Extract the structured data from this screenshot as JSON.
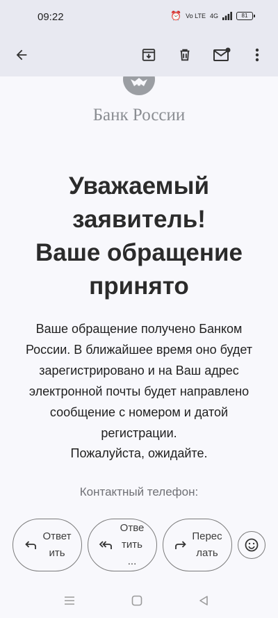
{
  "status_bar": {
    "time": "09:22",
    "volte": "Vo LTE",
    "network": "4G",
    "battery": "81"
  },
  "toolbar": {
    "icons": [
      "back-arrow-icon",
      "archive-icon",
      "delete-icon",
      "mark-unread-icon",
      "more-vert-icon"
    ]
  },
  "email": {
    "bank_name": "Банк России",
    "heading_lines": [
      "Уважаемый",
      "заявитель!",
      "Ваше обращение",
      "принято"
    ],
    "body_lines": [
      "Ваше обращение получено Банком",
      "России. В ближайшее время оно будет",
      "зарегистрировано и на Ваш адрес",
      "электронной почты будет направлено",
      "сообщение с номером и датой",
      "регистрации."
    ],
    "wait": "Пожалуйста, ожидайте.",
    "phone_label": "Контактный телефон:"
  },
  "actions": {
    "reply": [
      "Ответ",
      "ить"
    ],
    "reply_all": [
      "Отве",
      "тить ..."
    ],
    "forward": [
      "Перес",
      "лать"
    ],
    "emoji_icon": "emoji-icon"
  },
  "colors": {
    "header_bg": "#e8e9f1",
    "page_bg": "#f8f8fc",
    "text": "#202124",
    "muted": "#8a8d92"
  }
}
